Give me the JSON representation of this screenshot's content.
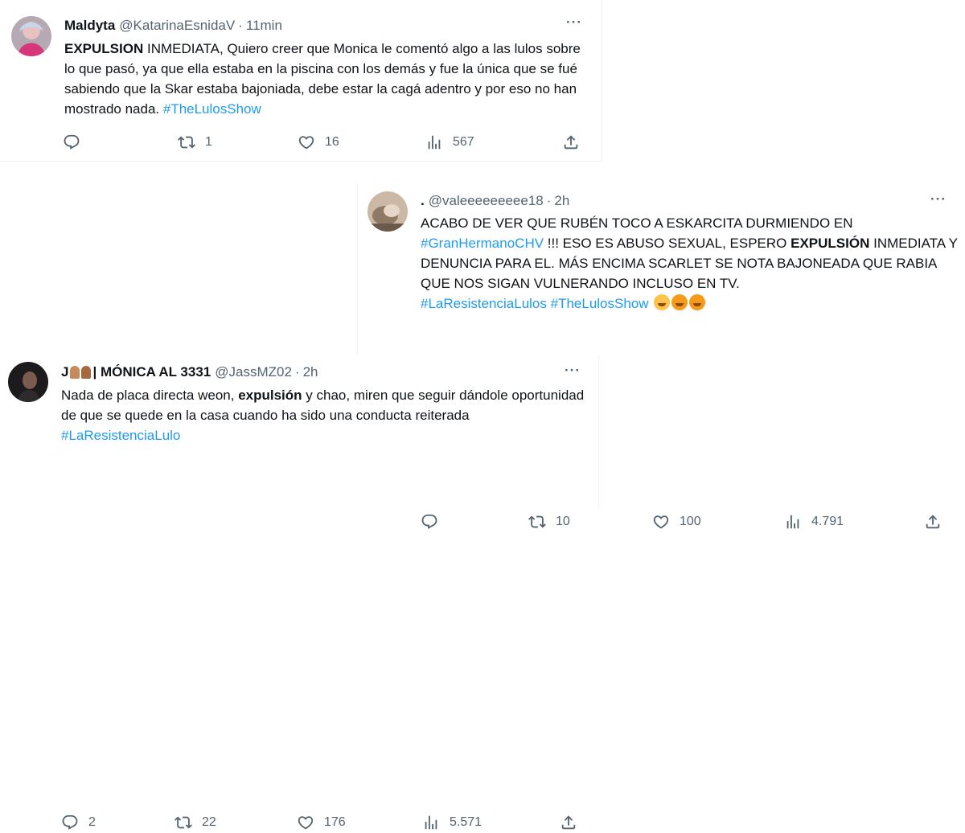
{
  "tweets": [
    {
      "name": "Maldyta",
      "handle": "@KatarinaEsnidaV",
      "dot": "·",
      "time": "11min",
      "more": "···",
      "body": {
        "bold": "EXPULSION",
        "text": " INMEDIATA, Quiero creer que Monica le comentó algo a las lulos sobre lo que pasó, ya que ella estaba en la piscina con los demás y fue la única que se fué sabiendo que la Skar estaba bajoniada, debe estar la cagá adentro y por eso no han mostrado nada.  ",
        "hashtag": "#TheLulosShow"
      },
      "stats": {
        "replies": "",
        "retweets": "1",
        "likes": "16",
        "views": "567"
      }
    },
    {
      "name": ".",
      "handle": "@valeeeeeeeee18",
      "dot": "·",
      "time": "2h",
      "more": "···",
      "body": {
        "text1": "ACABO DE VER QUE RUBÉN TOCO A ESKARCITA DURMIENDO EN ",
        "hashtag1": "#GranHermanoCHV",
        "text2": " !!! ESO ES ABUSO SEXUAL, ESPERO ",
        "bold": "EXPULSIÓN",
        "text3": " INMEDIATA Y DENUNCIA PARA EL. MÁS ENCIMA SCARLET SE NOTA BAJONEADA QUE RABIA QUE NOS SIGAN VULNERANDO INCLUSO EN TV.",
        "hashtag2": "#LaResistenciaLulos",
        "hashtag3": "#TheLulosShow",
        "emojis": [
          "loudly-crying-face",
          "face-with-steam",
          "face-with-steam"
        ]
      },
      "stats": {
        "replies": "",
        "retweets": "10",
        "likes": "100",
        "views": "4.791"
      }
    },
    {
      "name": "J",
      "name_suffix": "| MÓNICA AL 3331",
      "handle": "@JassMZ02",
      "dot": "·",
      "time": "2h",
      "more": "···",
      "body": {
        "text1": "Nada de placa directa weon, ",
        "bold": "expulsión",
        "text2": " y chao, miren que seguir dándole oportunidad de que se quede en la casa cuando ha sido una conducta reiterada ",
        "hashtag": "#LaResistenciaLulo"
      },
      "stats": {
        "replies": "2",
        "retweets": "22",
        "likes": "176",
        "views": "5.571"
      }
    }
  ],
  "icons": [
    "reply-icon",
    "retweet-icon",
    "like-icon",
    "views-icon",
    "share-icon"
  ],
  "colors": {
    "link": "#1d9bf0",
    "muted": "#536471",
    "text": "#0f1419",
    "border": "#eff3f4"
  }
}
